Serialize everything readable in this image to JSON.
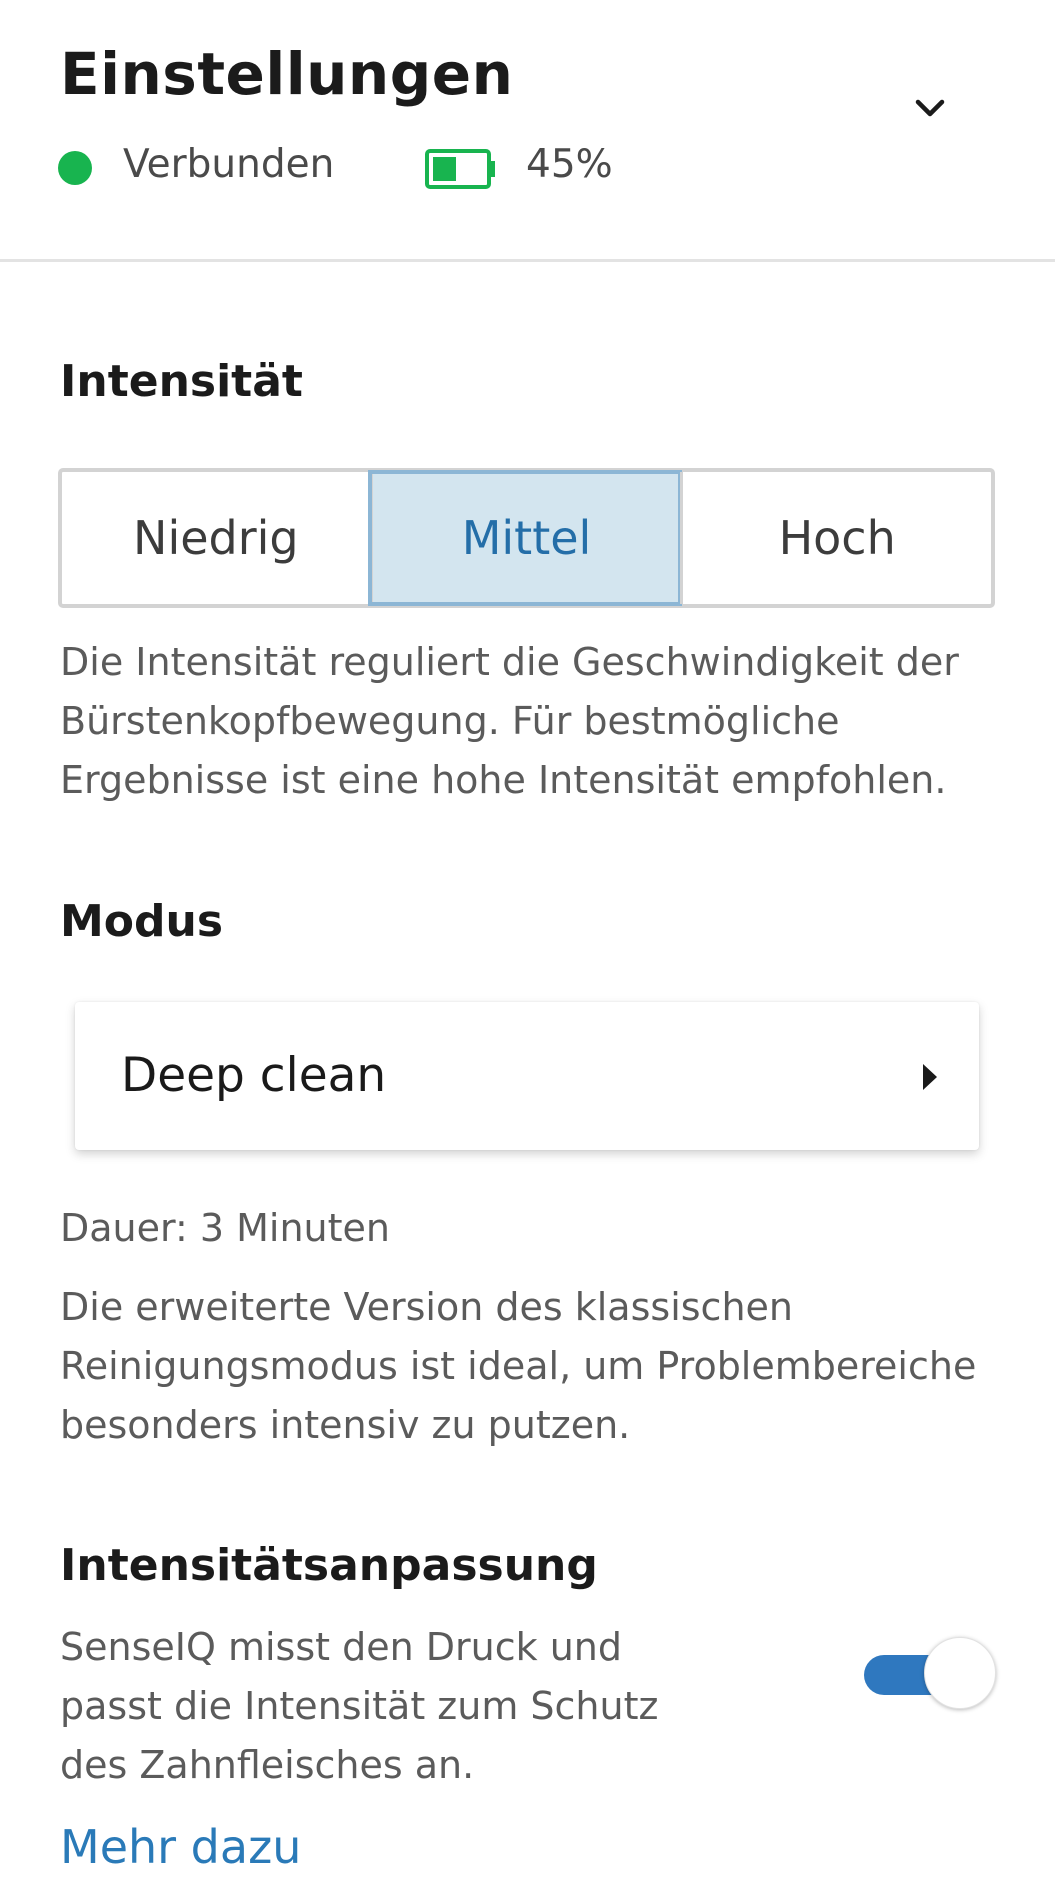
{
  "header": {
    "title": "Einstellungen",
    "status": {
      "label": "Verbunden",
      "color": "#18b44f"
    },
    "battery": {
      "percent_label": "45%",
      "level": 0.45,
      "color": "#18b44f"
    },
    "collapse_icon": "chevron-down-icon"
  },
  "intensity": {
    "title": "Intensität",
    "options": [
      "Niedrig",
      "Mittel",
      "Hoch"
    ],
    "selected": "Mittel",
    "description": "Die Intensität reguliert die Geschwindigkeit der Bürstenkopfbewegung. Für bestmögliche Ergebnisse ist eine hohe Intensität empfohlen."
  },
  "mode": {
    "title": "Modus",
    "selected_mode": "Deep clean",
    "arrow_icon": "caret-right-icon",
    "duration": "Dauer: 3 Minuten",
    "description": "Die erweiterte Version des klassischen Reinigungsmodus ist ideal, um Problembereiche besonders intensiv zu putzen."
  },
  "adjustment": {
    "title": "Intensitätsanpassung",
    "description": "SenseIQ misst den Druck und passt die Intensität zum Schutz des Zahnfleisches an.",
    "toggle_on": true,
    "toggle_color": "#2f78bf",
    "more_link": "Mehr dazu"
  },
  "colors": {
    "accent": "#2a7ab8",
    "selected_segment_bg": "#d3e5ef"
  }
}
